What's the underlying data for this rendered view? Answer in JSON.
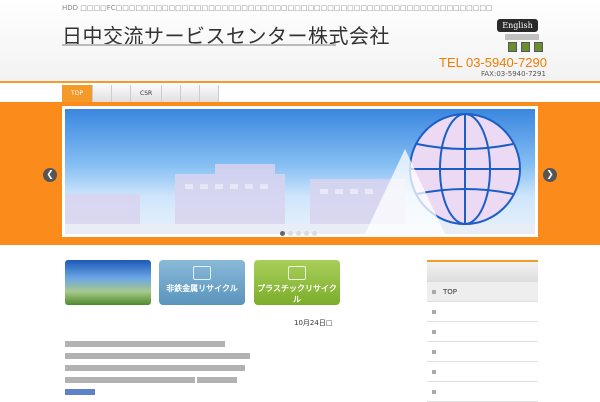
{
  "header": {
    "tagline": "HDD □□□□FC□□□□□□□□□□□□□□□□□□□□□□□□□□□□□□□□□□□□□□□□□□□□□□□□□□□□□□□□□",
    "logo": "日中交流サービスセンター株式会社",
    "english_button": "English",
    "tel": "TEL 03-5940-7290",
    "fax": "FAX:03-5940-7291"
  },
  "nav": {
    "items": [
      "TOP",
      "",
      "",
      "CSR",
      "",
      "",
      ""
    ]
  },
  "slider": {
    "prev": "❮",
    "next": "❯",
    "slides": 5,
    "active_slide": 1
  },
  "cards": {
    "metal": "非鉄金属リサイクル",
    "plastic": "プラスチックリサイクル"
  },
  "news": {
    "date": "10月24日□"
  },
  "sidebar": {
    "heading": "",
    "items": [
      "TOP",
      "",
      "",
      "",
      "",
      ""
    ]
  },
  "colors": {
    "accent": "#f39a2b",
    "slider_band": "#fb8c1c",
    "tel": "#f07d00"
  }
}
